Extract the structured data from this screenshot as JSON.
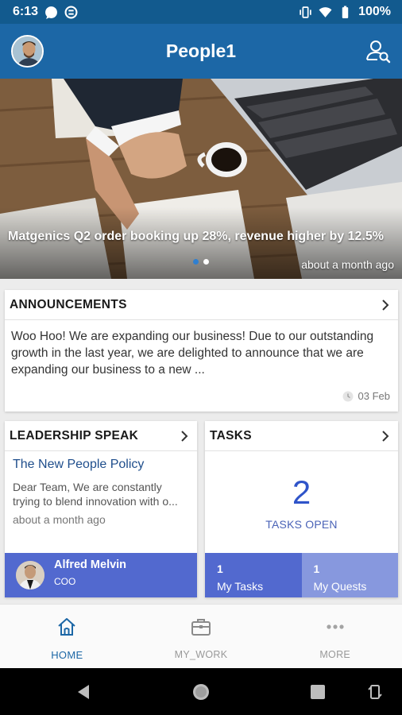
{
  "status_bar": {
    "time": "6:13",
    "battery": "100%"
  },
  "app_bar": {
    "title": "People1"
  },
  "hero": {
    "headline": "Matgenics Q2 order booking up 28%, revenue higher by 12.5%",
    "time": "about a month ago",
    "active_slide": 1,
    "slide_count": 2
  },
  "announcements": {
    "title": "ANNOUNCEMENTS",
    "body": "Woo Hoo! We are expanding our business! Due to our outstanding growth in the last year, we are delighted to announce that we are expanding our business to a new ...",
    "date": "03 Feb"
  },
  "leadership": {
    "title": "LEADERSHIP SPEAK",
    "post_title": "The New People Policy",
    "excerpt": "Dear Team, We are constantly trying to blend innovation with o...",
    "time": "about a month ago",
    "author_name": "Alfred Melvin",
    "author_role": "COO"
  },
  "tasks": {
    "title": "TASKS",
    "open_count": "2",
    "open_label": "TASKS OPEN",
    "my_tasks_count": "1",
    "my_tasks_label": "My Tasks",
    "my_quests_count": "1",
    "my_quests_label": "My Quests"
  },
  "bottom_nav": {
    "home": "HOME",
    "my_work": "MY_WORK",
    "more": "MORE"
  },
  "colors": {
    "status_bar": "#125a8e",
    "app_bar": "#1c67a6",
    "card_footer": "#5269cf",
    "quests_footer": "#8798de",
    "tasks_count": "#2f54c9"
  },
  "icons": {
    "status": [
      "notification-bubble-icon",
      "sync-icon",
      "vibrate-icon",
      "wifi-icon",
      "battery-icon"
    ],
    "app_bar": [
      "profile-avatar",
      "user-search-icon"
    ],
    "nav": [
      "home-icon",
      "briefcase-icon",
      "more-dots-icon"
    ]
  }
}
